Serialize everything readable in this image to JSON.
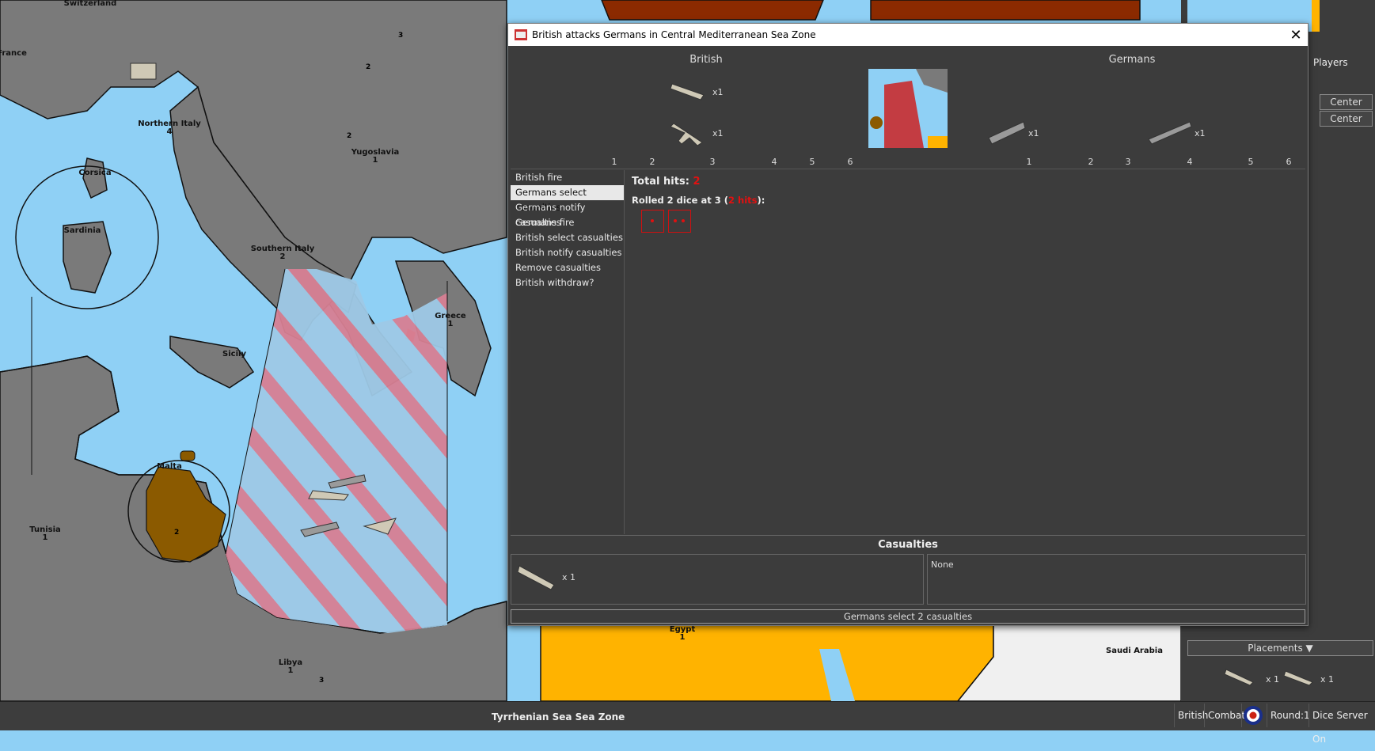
{
  "map": {
    "territories": [
      {
        "name": "Switzerland",
        "count": ""
      },
      {
        "name": "France",
        "count": ""
      },
      {
        "name": "Northern Italy",
        "count": "4"
      },
      {
        "name": "Corsica",
        "count": ""
      },
      {
        "name": "Sardinia",
        "count": ""
      },
      {
        "name": "Yugoslavia",
        "count": "1"
      },
      {
        "name": "Southern Italy",
        "count": "2"
      },
      {
        "name": "Sicily",
        "count": ""
      },
      {
        "name": "Greece",
        "count": "1"
      },
      {
        "name": "Malta",
        "count": ""
      },
      {
        "name": "Tunisia",
        "count": "1"
      },
      {
        "name": "Libya",
        "count": "1"
      },
      {
        "name": "Egypt",
        "count": "1"
      },
      {
        "name": "Saudi Arabia",
        "count": ""
      }
    ],
    "unit_counts": [
      "3",
      "2",
      "2",
      "2",
      "3"
    ]
  },
  "dialog": {
    "title": "British attacks Germans in Central Mediterranean Sea Zone",
    "attacker": "British",
    "defender": "Germans",
    "attacker_units": [
      {
        "label": "x1",
        "icon": "cruiser-icon"
      },
      {
        "label": "x1",
        "icon": "fighter-icon"
      }
    ],
    "defender_units": [
      {
        "label": "x1",
        "icon": "transport-icon"
      },
      {
        "label": "x1",
        "icon": "battleship-icon"
      }
    ],
    "dice_numbers_left": [
      "1",
      "2",
      "3",
      "4",
      "5",
      "6"
    ],
    "dice_numbers_right": [
      "1",
      "2",
      "3",
      "4",
      "5",
      "6"
    ],
    "steps": [
      "British fire",
      "Germans select casualties",
      "Germans notify casualties",
      "Germans fire",
      "British select casualties",
      "British notify casualties",
      "Remove casualties",
      "British withdraw?"
    ],
    "selected_step": 1,
    "total_hits_label": "Total hits:",
    "total_hits_value": "2",
    "rolled_prefix": "Rolled 2 dice at 3 (",
    "rolled_hits": "2 hits",
    "rolled_suffix": "):",
    "dice_results": [
      1,
      2
    ],
    "casualties_title": "Casualties",
    "casualty_attacker": "x 1",
    "casualty_defender": "None",
    "action_button": "Germans select 2 casualties",
    "close_symbol": "✕"
  },
  "right_panel": {
    "players_tab": "Players",
    "center_1": "Center",
    "center_2": "Center",
    "placements": "Placements ▼",
    "placement_units": [
      "x 1",
      "x 1"
    ]
  },
  "status_bar": {
    "location": "Tyrrhenian Sea Sea Zone",
    "player": "British",
    "phase": "Combat",
    "round": "Round:1",
    "dice_server": "Dice Server On"
  },
  "colors": {
    "sea": "#8fd0f5",
    "land_neutral": "#7a7a7a",
    "british": "#ffb300",
    "italy": "#8b5a00",
    "russia": "#8b2a00",
    "dialog_bg": "#3c3c3c",
    "hit_red": "#e31010"
  }
}
